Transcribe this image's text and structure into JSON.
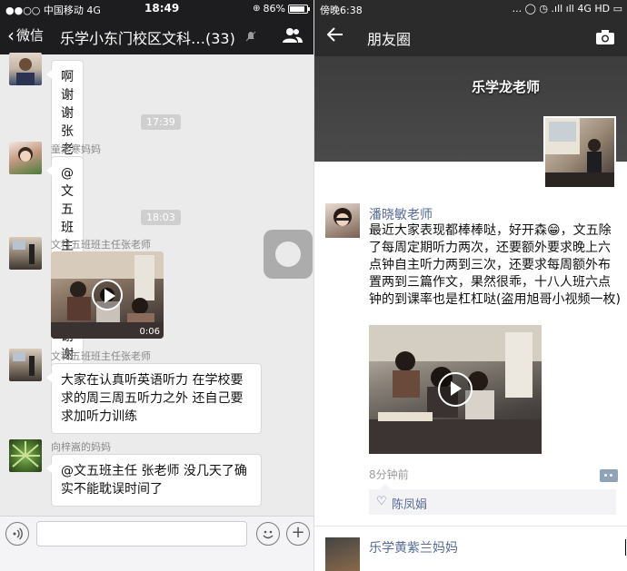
{
  "chat": {
    "status": {
      "carrier": "●●○○ 中国移动  4G",
      "time": "18:49",
      "battery": "86%"
    },
    "header": {
      "back_label": "微信",
      "title": "乐学小东门校区文科…(33)"
    },
    "messages": [
      {
        "sender": "",
        "text": "啊谢谢张老师"
      },
      {
        "sender": "童紫寒妈妈",
        "text": "@文五班主任 张老师 谢谢老师"
      },
      {
        "sender": "文科五班班主任张老师",
        "video_duration": "0:06"
      },
      {
        "sender": "文科五班班主任张老师",
        "text": "大家在认真听英语听力 在学校要求的周三周五听力之外 还自己要求加听力训练"
      },
      {
        "sender": "向梓嵩的妈妈",
        "text": "@文五班主任 张老师 没几天了确实不能耽误时间了"
      }
    ],
    "timestamps": [
      "17:39",
      "18:03"
    ],
    "input": {
      "plus_label": "+"
    }
  },
  "moments": {
    "status": {
      "time": "傍晚6:38",
      "icons": "... ◯ ◷ .ıll ıll 4G HD ▭"
    },
    "header": {
      "title": "朋友圈"
    },
    "cover_name": "乐学龙老师",
    "post": {
      "author": "潘晓敏老师",
      "text": "最近大家表现都棒棒哒，好开森😁，文五除了每周定期听力两次，还要额外要求晚上六点钟自主听力两到三次，还要求每周额外布置两到三篇作文，果然很乖，十八人班六点钟的到课率也是杠杠哒(盗用旭哥小视频一枚)",
      "time": "8分钟前",
      "likes": "陈凤娟"
    },
    "next_post_author": "乐学黄紫兰妈妈"
  }
}
